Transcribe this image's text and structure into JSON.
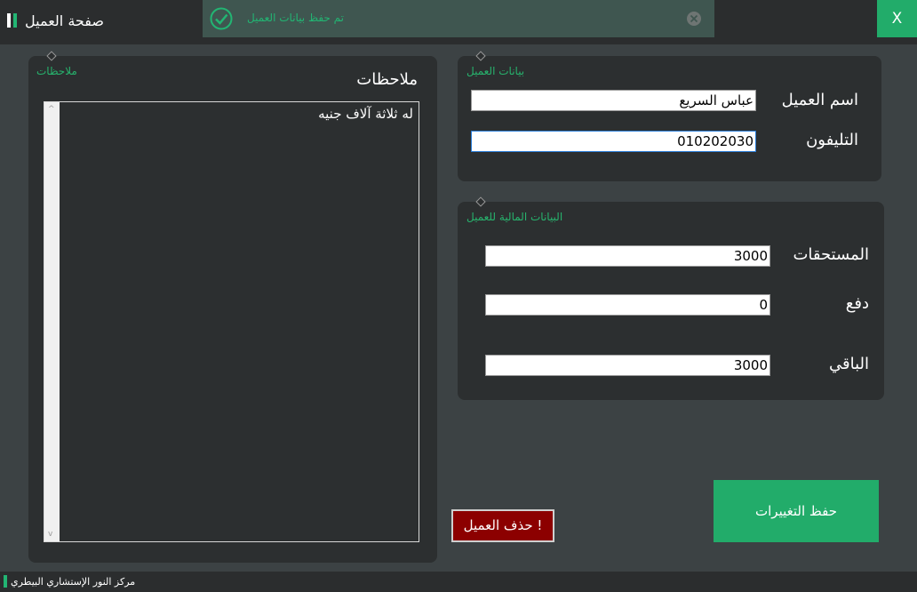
{
  "window": {
    "title": "صفحة العميل",
    "close_label": "X"
  },
  "toast": {
    "message": "تم حفظ بيانات العميل"
  },
  "customer_info": {
    "caption": "بيانات العميل",
    "name_label": "اسم العميل",
    "name_value": "عباس السريع",
    "phone_label": "التليفون",
    "phone_value": "010202030"
  },
  "financial": {
    "caption": "البيانات المالية للعميل",
    "dues_label": "المستحقات",
    "dues_value": "3000",
    "paid_label": "دفع",
    "paid_value": "0",
    "remaining_label": "الباقي",
    "remaining_value": "3000"
  },
  "notes": {
    "caption": "ملاحظات",
    "heading": "ملاحظات",
    "text": "له ثلاثة آلاف جنيه"
  },
  "actions": {
    "save_label": "حفظ التغييرات",
    "delete_label": "حذف العميل !"
  },
  "status": {
    "text": "مركز النور الإستشاري البيطري"
  },
  "colors": {
    "accent": "#22ac6a",
    "background": "#3c4244",
    "panel": "#2c2f30",
    "danger": "#8c0000"
  },
  "icons": {
    "toast": "check-circle-icon",
    "toast_close": "close-circle-icon",
    "title": "window-bars-icon"
  }
}
